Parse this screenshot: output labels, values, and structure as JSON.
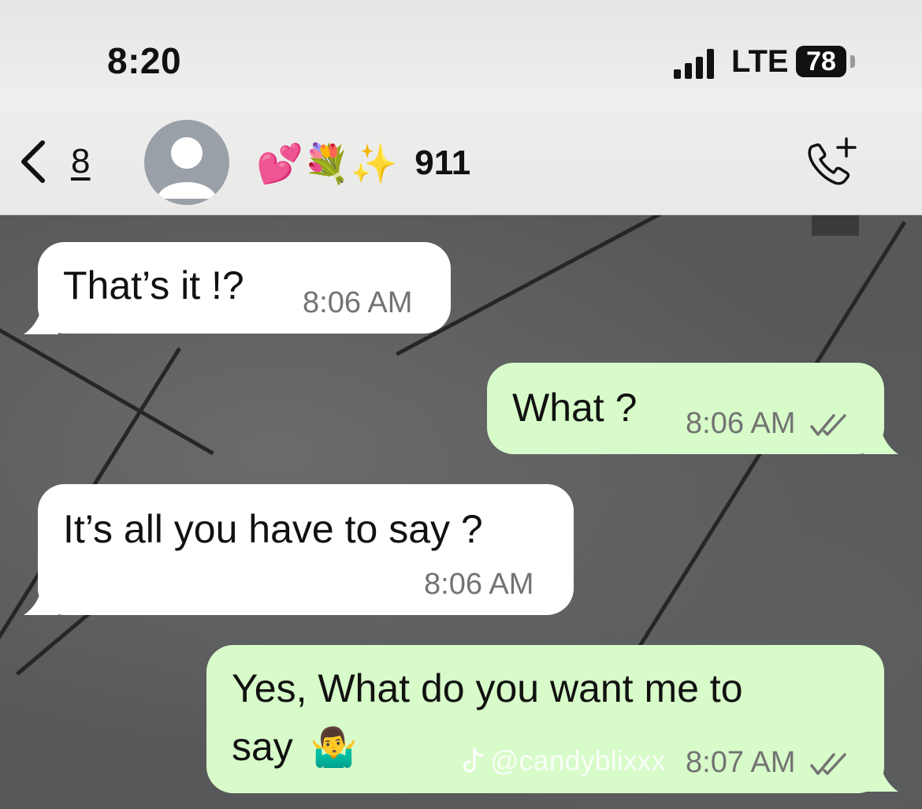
{
  "status_bar": {
    "time": "8:20",
    "network": "LTE",
    "battery": "78"
  },
  "header": {
    "back_count": "8",
    "contact_emojis": "💕💐✨",
    "contact_number": "911",
    "icons": {
      "back": "chevron-left-icon",
      "avatar": "person-icon",
      "call": "add-call-icon"
    }
  },
  "messages": [
    {
      "direction": "incoming",
      "text": "That’s it !?",
      "time": "8:06 AM"
    },
    {
      "direction": "outgoing",
      "text": "What ?",
      "time": "8:06 AM",
      "status": "read"
    },
    {
      "direction": "incoming",
      "text": "It’s all you have to say ?",
      "time": "8:06 AM"
    },
    {
      "direction": "outgoing",
      "text_line1": "Yes, What do you want me to",
      "text_line2": "say",
      "emoji": "🤷‍♂️",
      "time": "8:07 AM",
      "status": "read"
    }
  ],
  "watermark": "@candyblixxx",
  "colors": {
    "incoming": "#ffffff",
    "outgoing": "#d7fbc9",
    "header": "#e9e9e7",
    "read_ticks": "#737373"
  }
}
